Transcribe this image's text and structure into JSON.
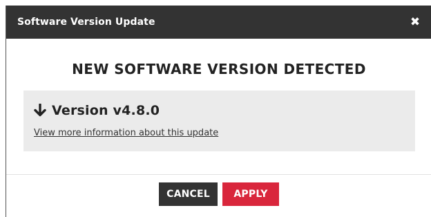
{
  "dialog": {
    "title": "Software Version Update",
    "close_icon": "close-icon",
    "heading": "NEW SOFTWARE VERSION DETECTED",
    "version_icon": "arrow-down-icon",
    "version_label": "Version v4.8.0",
    "info_link": "View more information about this update",
    "cancel_label": "CANCEL",
    "apply_label": "APPLY"
  },
  "colors": {
    "titlebar": "#333333",
    "panel": "#ebebeb",
    "cancel": "#333333",
    "apply": "#d9263c"
  }
}
